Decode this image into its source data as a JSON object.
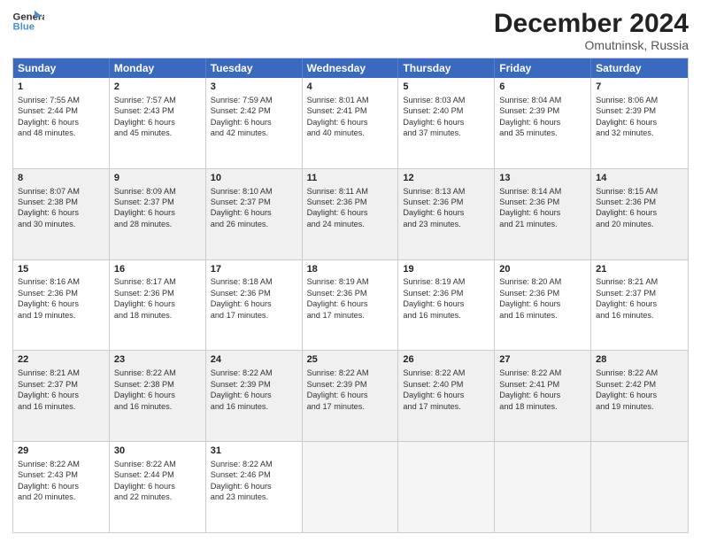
{
  "header": {
    "logo_line1": "General",
    "logo_line2": "Blue",
    "month": "December 2024",
    "location": "Omutninsk, Russia"
  },
  "days_of_week": [
    "Sunday",
    "Monday",
    "Tuesday",
    "Wednesday",
    "Thursday",
    "Friday",
    "Saturday"
  ],
  "rows": [
    [
      {
        "num": "1",
        "lines": [
          "Sunrise: 7:55 AM",
          "Sunset: 2:44 PM",
          "Daylight: 6 hours",
          "and 48 minutes."
        ]
      },
      {
        "num": "2",
        "lines": [
          "Sunrise: 7:57 AM",
          "Sunset: 2:43 PM",
          "Daylight: 6 hours",
          "and 45 minutes."
        ]
      },
      {
        "num": "3",
        "lines": [
          "Sunrise: 7:59 AM",
          "Sunset: 2:42 PM",
          "Daylight: 6 hours",
          "and 42 minutes."
        ]
      },
      {
        "num": "4",
        "lines": [
          "Sunrise: 8:01 AM",
          "Sunset: 2:41 PM",
          "Daylight: 6 hours",
          "and 40 minutes."
        ]
      },
      {
        "num": "5",
        "lines": [
          "Sunrise: 8:03 AM",
          "Sunset: 2:40 PM",
          "Daylight: 6 hours",
          "and 37 minutes."
        ]
      },
      {
        "num": "6",
        "lines": [
          "Sunrise: 8:04 AM",
          "Sunset: 2:39 PM",
          "Daylight: 6 hours",
          "and 35 minutes."
        ]
      },
      {
        "num": "7",
        "lines": [
          "Sunrise: 8:06 AM",
          "Sunset: 2:39 PM",
          "Daylight: 6 hours",
          "and 32 minutes."
        ]
      }
    ],
    [
      {
        "num": "8",
        "lines": [
          "Sunrise: 8:07 AM",
          "Sunset: 2:38 PM",
          "Daylight: 6 hours",
          "and 30 minutes."
        ]
      },
      {
        "num": "9",
        "lines": [
          "Sunrise: 8:09 AM",
          "Sunset: 2:37 PM",
          "Daylight: 6 hours",
          "and 28 minutes."
        ]
      },
      {
        "num": "10",
        "lines": [
          "Sunrise: 8:10 AM",
          "Sunset: 2:37 PM",
          "Daylight: 6 hours",
          "and 26 minutes."
        ]
      },
      {
        "num": "11",
        "lines": [
          "Sunrise: 8:11 AM",
          "Sunset: 2:36 PM",
          "Daylight: 6 hours",
          "and 24 minutes."
        ]
      },
      {
        "num": "12",
        "lines": [
          "Sunrise: 8:13 AM",
          "Sunset: 2:36 PM",
          "Daylight: 6 hours",
          "and 23 minutes."
        ]
      },
      {
        "num": "13",
        "lines": [
          "Sunrise: 8:14 AM",
          "Sunset: 2:36 PM",
          "Daylight: 6 hours",
          "and 21 minutes."
        ]
      },
      {
        "num": "14",
        "lines": [
          "Sunrise: 8:15 AM",
          "Sunset: 2:36 PM",
          "Daylight: 6 hours",
          "and 20 minutes."
        ]
      }
    ],
    [
      {
        "num": "15",
        "lines": [
          "Sunrise: 8:16 AM",
          "Sunset: 2:36 PM",
          "Daylight: 6 hours",
          "and 19 minutes."
        ]
      },
      {
        "num": "16",
        "lines": [
          "Sunrise: 8:17 AM",
          "Sunset: 2:36 PM",
          "Daylight: 6 hours",
          "and 18 minutes."
        ]
      },
      {
        "num": "17",
        "lines": [
          "Sunrise: 8:18 AM",
          "Sunset: 2:36 PM",
          "Daylight: 6 hours",
          "and 17 minutes."
        ]
      },
      {
        "num": "18",
        "lines": [
          "Sunrise: 8:19 AM",
          "Sunset: 2:36 PM",
          "Daylight: 6 hours",
          "and 17 minutes."
        ]
      },
      {
        "num": "19",
        "lines": [
          "Sunrise: 8:19 AM",
          "Sunset: 2:36 PM",
          "Daylight: 6 hours",
          "and 16 minutes."
        ]
      },
      {
        "num": "20",
        "lines": [
          "Sunrise: 8:20 AM",
          "Sunset: 2:36 PM",
          "Daylight: 6 hours",
          "and 16 minutes."
        ]
      },
      {
        "num": "21",
        "lines": [
          "Sunrise: 8:21 AM",
          "Sunset: 2:37 PM",
          "Daylight: 6 hours",
          "and 16 minutes."
        ]
      }
    ],
    [
      {
        "num": "22",
        "lines": [
          "Sunrise: 8:21 AM",
          "Sunset: 2:37 PM",
          "Daylight: 6 hours",
          "and 16 minutes."
        ]
      },
      {
        "num": "23",
        "lines": [
          "Sunrise: 8:22 AM",
          "Sunset: 2:38 PM",
          "Daylight: 6 hours",
          "and 16 minutes."
        ]
      },
      {
        "num": "24",
        "lines": [
          "Sunrise: 8:22 AM",
          "Sunset: 2:39 PM",
          "Daylight: 6 hours",
          "and 16 minutes."
        ]
      },
      {
        "num": "25",
        "lines": [
          "Sunrise: 8:22 AM",
          "Sunset: 2:39 PM",
          "Daylight: 6 hours",
          "and 17 minutes."
        ]
      },
      {
        "num": "26",
        "lines": [
          "Sunrise: 8:22 AM",
          "Sunset: 2:40 PM",
          "Daylight: 6 hours",
          "and 17 minutes."
        ]
      },
      {
        "num": "27",
        "lines": [
          "Sunrise: 8:22 AM",
          "Sunset: 2:41 PM",
          "Daylight: 6 hours",
          "and 18 minutes."
        ]
      },
      {
        "num": "28",
        "lines": [
          "Sunrise: 8:22 AM",
          "Sunset: 2:42 PM",
          "Daylight: 6 hours",
          "and 19 minutes."
        ]
      }
    ],
    [
      {
        "num": "29",
        "lines": [
          "Sunrise: 8:22 AM",
          "Sunset: 2:43 PM",
          "Daylight: 6 hours",
          "and 20 minutes."
        ]
      },
      {
        "num": "30",
        "lines": [
          "Sunrise: 8:22 AM",
          "Sunset: 2:44 PM",
          "Daylight: 6 hours",
          "and 22 minutes."
        ]
      },
      {
        "num": "31",
        "lines": [
          "Sunrise: 8:22 AM",
          "Sunset: 2:46 PM",
          "Daylight: 6 hours",
          "and 23 minutes."
        ]
      },
      null,
      null,
      null,
      null
    ]
  ]
}
